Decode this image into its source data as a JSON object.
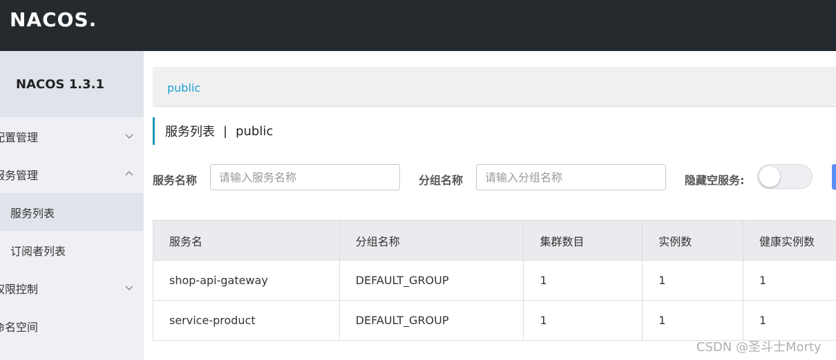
{
  "header": {
    "logo_text": "NACOS."
  },
  "sidebar": {
    "version": "NACOS 1.3.1",
    "items": [
      {
        "label": "配置管理",
        "expanded": false
      },
      {
        "label": "服务管理",
        "expanded": true
      },
      {
        "label": "服务列表",
        "active": true
      },
      {
        "label": "订阅者列表",
        "active": false
      },
      {
        "label": "权限控制",
        "expanded": false
      },
      {
        "label": "命名空间"
      }
    ]
  },
  "breadcrumb": {
    "namespace": "public"
  },
  "page": {
    "title": "服务列表",
    "separator": "|",
    "namespace": "public"
  },
  "filters": {
    "service_name_label": "服务名称",
    "service_name_placeholder": "请输入服务名称",
    "group_name_label": "分组名称",
    "group_name_placeholder": "请输入分组名称",
    "hide_empty_label": "隐藏空服务:",
    "hide_empty_on": false
  },
  "table": {
    "headers": [
      "服务名",
      "分组名称",
      "集群数目",
      "实例数",
      "健康实例数"
    ],
    "rows": [
      [
        "shop-api-gateway",
        "DEFAULT_GROUP",
        "1",
        "1",
        "1"
      ],
      [
        "service-product",
        "DEFAULT_GROUP",
        "1",
        "1",
        "1"
      ]
    ]
  },
  "watermark": "CSDN @圣斗士Morty",
  "colors": {
    "topbar": "#252a2f",
    "accent": "#1896b4",
    "link": "#1ea0d4"
  }
}
